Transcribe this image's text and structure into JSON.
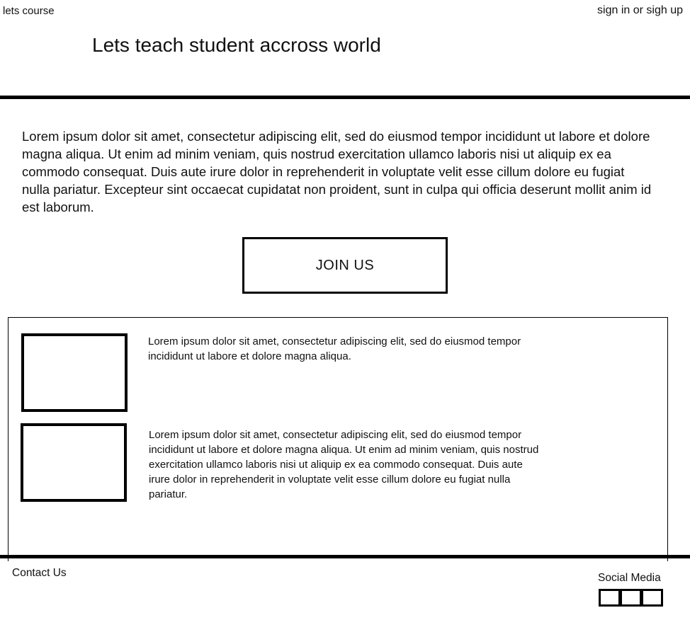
{
  "header": {
    "brand": "lets course",
    "auth_link": "sign in or sigh up",
    "headline": "Lets teach student accross world"
  },
  "intro": {
    "text": "Lorem ipsum dolor sit amet, consectetur adipiscing elit, sed do eiusmod tempor incididunt ut labore et dolore magna aliqua. Ut enim ad minim veniam, quis nostrud exercitation ullamco laboris nisi ut aliquip ex ea commodo consequat. Duis aute irure dolor in reprehenderit in voluptate velit esse cillum dolore eu fugiat nulla pariatur. Excepteur sint occaecat cupidatat non proident, sunt in culpa qui officia deserunt mollit anim id est laborum."
  },
  "cta": {
    "label": "JOIN US"
  },
  "features": [
    {
      "image_icon": "image-placeholder-icon",
      "text": "Lorem ipsum dolor sit amet, consectetur adipiscing elit, sed do eiusmod tempor incididunt ut labore et dolore magna aliqua."
    },
    {
      "image_icon": "image-placeholder-icon",
      "text": "Lorem ipsum dolor sit amet, consectetur adipiscing elit, sed do eiusmod tempor incididunt ut labore et dolore magna aliqua. Ut enim ad minim veniam, quis nostrud exercitation ullamco laboris nisi ut aliquip ex ea commodo consequat. Duis aute irure dolor in reprehenderit in voluptate velit esse cillum dolore eu fugiat nulla pariatur."
    }
  ],
  "footer": {
    "contact": "Contact Us",
    "social_label": "Social Media",
    "social_icons": [
      "social-icon",
      "social-icon",
      "social-icon"
    ]
  },
  "colors": {
    "background": "#ffffff",
    "ink": "#000000"
  }
}
